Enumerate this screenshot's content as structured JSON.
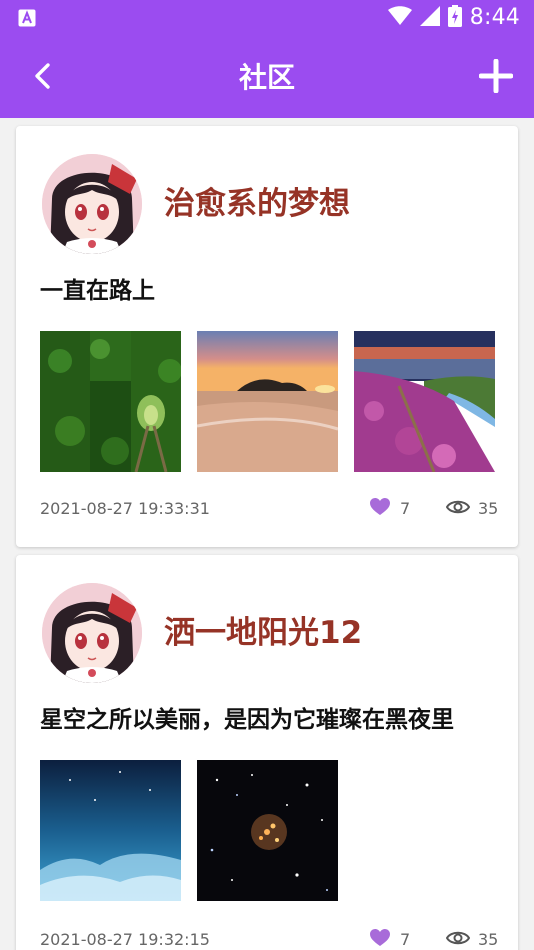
{
  "status_bar": {
    "time": "8:44"
  },
  "app_bar": {
    "title": "社区"
  },
  "posts": [
    {
      "author": "治愈系的梦想",
      "text": "一直在路上",
      "date": "2021-08-27 19:33:31",
      "likes": "7",
      "views": "35",
      "images": [
        "forest-tunnel-photo",
        "beach-sunset-photo",
        "flower-hillside-photo"
      ]
    },
    {
      "author": "洒一地阳光12",
      "text": "星空之所以美丽，是因为它璀璨在黑夜里",
      "date": "2021-08-27 19:32:15",
      "likes": "7",
      "views": "35",
      "images": [
        "blue-sky-photo",
        "star-cluster-photo"
      ]
    }
  ],
  "colors": {
    "accent": "#9b4cf0",
    "author": "#963326",
    "like": "#a86bd9"
  },
  "icons": [
    "app-notification-icon",
    "wifi-icon",
    "cell-signal-icon",
    "battery-icon",
    "back-arrow-icon",
    "add-icon",
    "heart-icon",
    "eye-icon"
  ]
}
